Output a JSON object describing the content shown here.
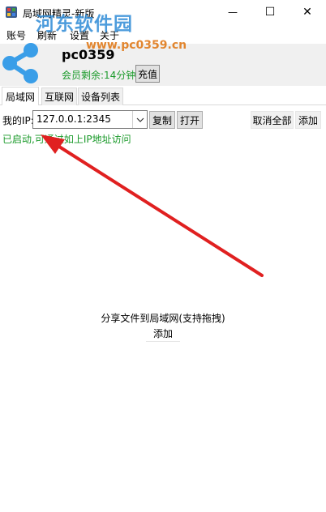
{
  "window": {
    "title": "局域网精灵-新版",
    "minimize_glyph": "—",
    "maximize_glyph": "☐",
    "close_glyph": "✕"
  },
  "menu": {
    "items": [
      "账号",
      "刷新",
      "设置",
      "关于"
    ]
  },
  "watermark": {
    "title": "河东软件园",
    "url": "www.pc0359.cn"
  },
  "account": {
    "username": "pc0359",
    "member_remaining": "会员剩余:14分钟",
    "recharge_label": "充值"
  },
  "tabs": [
    {
      "label": "局域网",
      "active": true
    },
    {
      "label": "互联网",
      "active": false
    },
    {
      "label": "设备列表",
      "active": false
    }
  ],
  "toolbar": {
    "my_ip_label": "我的IP:",
    "ip_value": "127.0.0.1:2345",
    "copy_label": "复制",
    "open_label": "打开",
    "cancel_all_label": "取消全部",
    "add_label": "添加"
  },
  "status": {
    "text": "已启动,可通过如上IP地址访问"
  },
  "share_area": {
    "hint": "分享文件到局域网(支持拖拽)",
    "add_label": "添加"
  },
  "colors": {
    "status_green": "#1a9a2a",
    "arrow_red": "#e02020",
    "logo_blue": "#3a9ee8",
    "watermark_blue": "#2e8bd6",
    "watermark_orange": "#e07a1a"
  },
  "icons": {
    "app": "app-icon",
    "logo": "share-icon",
    "dropdown": "chevron-down-icon"
  }
}
